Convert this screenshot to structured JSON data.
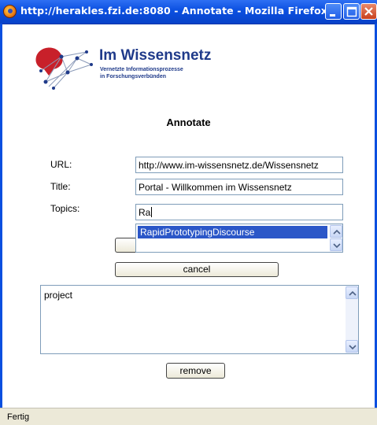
{
  "window": {
    "title": "http://herakles.fzi.de:8080 - Annotate - Mozilla Firefox"
  },
  "logo": {
    "title": "Im Wissensnetz",
    "subtitle_line1": "Vernetzte Informationsprozesse",
    "subtitle_line2": "in Forschungsverbünden"
  },
  "page": {
    "heading": "Annotate"
  },
  "form": {
    "url_label": "URL:",
    "url_value": "http://www.im-wissensnetz.de/Wissensnetz",
    "title_label": "Title:",
    "title_value": "Portal - Willkommen im Wissensnetz",
    "topics_label": "Topics:",
    "topics_value": "Ra"
  },
  "autocomplete": {
    "items": [
      "RapidPrototypingDiscourse"
    ]
  },
  "buttons": {
    "cancel_label": "cancel",
    "remove_label": "remove"
  },
  "topics_list": {
    "text": "project"
  },
  "statusbar": {
    "text": "Fertig"
  },
  "colors": {
    "titlebar": "#0a4fe0",
    "selection": "#2b57c8",
    "brand_blue": "#1f3a8a",
    "brand_red": "#c8202a"
  }
}
